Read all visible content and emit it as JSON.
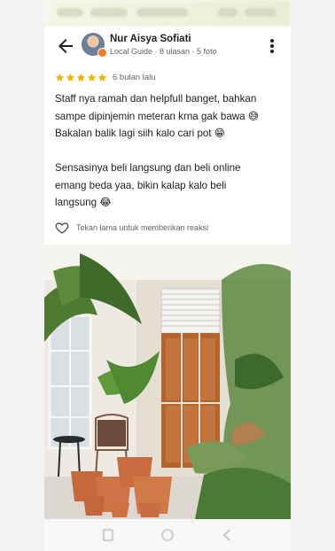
{
  "review": {
    "author_name": "Nur Aisya Sofiati",
    "author_meta": "Local Guide · 8 ulasan · 5 foto",
    "rating": 5,
    "date": "6 bulan lalu",
    "text": "Staff nya ramah dan helpfull banget, bahkan\nsampe dipinjemin meteran krna gak bawa 😅\nBakalan balik lagi siih kalo cari pot 😁\n\nSensasinya beli langsung dan beli online\nemang beda yaa, bikin kalap kalo beli\nlangsung 😂",
    "like_label": "Tekan lama untuk memberikan reaksi"
  },
  "icons": {
    "back": "arrow-back-icon",
    "more": "more-vertical-icon",
    "star": "star-icon",
    "heart": "heart-outline-icon",
    "nav_recent": "recent-apps-icon",
    "nav_home": "home-icon",
    "nav_back": "nav-back-icon"
  },
  "colors": {
    "star": "#f4b400",
    "text": "#202124",
    "secondary_text": "#5f6368",
    "badge": "#f47c20"
  }
}
